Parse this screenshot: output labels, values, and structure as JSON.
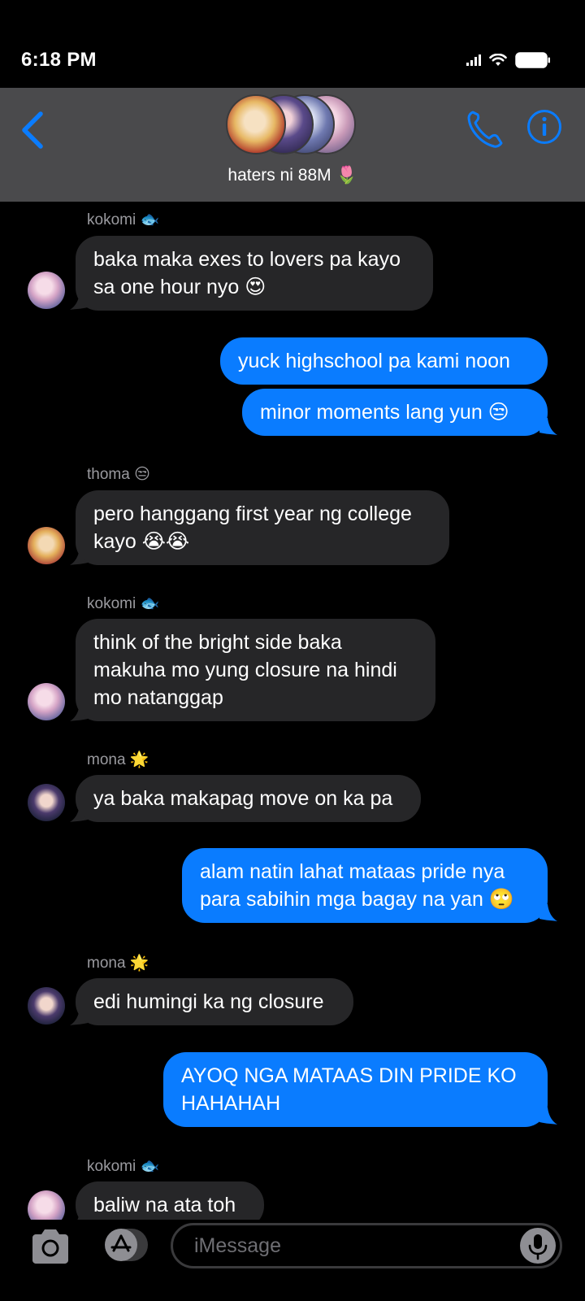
{
  "status_bar": {
    "time": "6:18 PM"
  },
  "header": {
    "group_name": "haters ni 88M 🌷",
    "icons": [
      "back-chevron-icon",
      "phone-icon",
      "info-icon"
    ]
  },
  "messages": [
    {
      "type": "received",
      "sender": "kokomi 🐟",
      "text": "baka maka exes to lovers pa kayo\nsa one hour nyo 😍"
    },
    {
      "type": "sent",
      "text": "yuck highschool pa kami noon"
    },
    {
      "type": "sent",
      "text": "minor moments lang yun 😒"
    },
    {
      "type": "received",
      "sender": "thoma 😒",
      "text": "pero hanggang first year ng college\nkayo 😭😭"
    },
    {
      "type": "received",
      "sender": "kokomi 🐟",
      "text": "think of the bright side baka\nmakuha mo yung closure na hindi\nmo natanggap"
    },
    {
      "type": "received",
      "sender": "mona 🌟",
      "text": "ya baka makapag move on ka pa"
    },
    {
      "type": "sent",
      "text": "alam natin lahat mataas pride nya\npara sabihin mga bagay na yan 🙄"
    },
    {
      "type": "received",
      "sender": "mona 🌟",
      "text": "edi humingi ka ng closure"
    },
    {
      "type": "sent",
      "text": "AYOQ NGA MATAAS DIN PRIDE KO\nHAHAHAH"
    },
    {
      "type": "received",
      "sender": "kokomi 🐟",
      "text": "baliw na ata toh"
    }
  ],
  "input_bar": {
    "placeholder": "iMessage"
  },
  "colors": {
    "sent_bubble": "#0a7cff",
    "received_bubble": "#262628",
    "header_bg": "#4a4a4c",
    "accent": "#0a7cff"
  }
}
